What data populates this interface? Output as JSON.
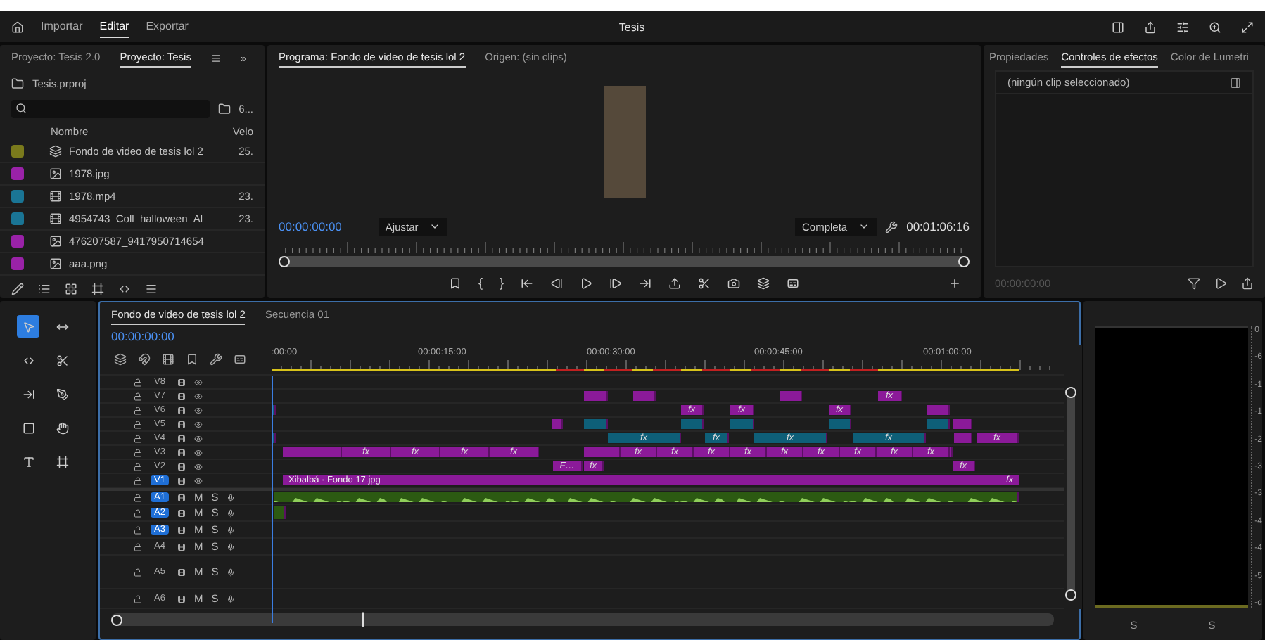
{
  "topbar": {
    "tabs": [
      {
        "label": "Importar",
        "selected": false
      },
      {
        "label": "Editar",
        "selected": true
      },
      {
        "label": "Exportar",
        "selected": false
      }
    ],
    "title": "Tesis"
  },
  "project": {
    "tabs": [
      {
        "label": "Proyecto: Tesis 2.0",
        "selected": false
      },
      {
        "label": "Proyecto: Tesis",
        "selected": true
      }
    ],
    "overflow": "»",
    "file": "Tesis.prproj",
    "count": "6...",
    "columns": [
      "Nombre",
      "Velo"
    ],
    "items": [
      {
        "name": "Fondo de video de tesis lol 2",
        "rate": "25.",
        "color": "#7a7a1c",
        "kind": "sequence",
        "selected": false
      },
      {
        "name": "1978.jpg",
        "color": "#9a22a8",
        "kind": "image",
        "selected": false
      },
      {
        "name": "1978.mp4",
        "rate": "23.",
        "color": "#1a7595",
        "kind": "video",
        "selected": false
      },
      {
        "name": "4954743_Coll_halloween_Al",
        "rate": "23.",
        "color": "#1a7595",
        "kind": "video",
        "selected": false
      },
      {
        "name": "476207587_9417950714654",
        "color": "#9a22a8",
        "kind": "image",
        "selected": false
      },
      {
        "name": "aaa.png",
        "color": "#9a22a8",
        "kind": "image",
        "selected": false
      }
    ]
  },
  "program": {
    "tabs": [
      {
        "label": "Programa: Fondo de video de tesis lol 2",
        "selected": true
      },
      {
        "label": "Origen: (sin clips)",
        "selected": false
      }
    ],
    "timecode": "00:00:00:00",
    "zoom": "Ajustar",
    "quality": "Completa",
    "duration": "00:01:06:16",
    "marks": [
      "{",
      "}"
    ]
  },
  "effects": {
    "tabs": [
      {
        "label": "Propiedades",
        "selected": false
      },
      {
        "label": "Controles de efectos",
        "selected": true
      },
      {
        "label": "Color de Lumetri",
        "selected": false
      }
    ],
    "message": "(ningún clip seleccionado)",
    "timecode": "00:00:00:00"
  },
  "timeline": {
    "tabs": [
      {
        "label": "Fondo de video de tesis lol 2",
        "selected": true
      },
      {
        "label": "Secuencia 01",
        "selected": false
      }
    ],
    "timecode": "00:00:00:00",
    "ruler": [
      ":00:00",
      "00:00:15:00",
      "00:00:30:00",
      "00:00:45:00",
      "00:01:00:00"
    ],
    "video_tracks": [
      {
        "name": "V8",
        "selected": false
      },
      {
        "name": "V7",
        "selected": false,
        "clips": [
          {
            "color": "#8b1a99"
          },
          {
            "color": "#8b1a99"
          },
          {
            "color": "#8b1a99"
          },
          {
            "color": "#8b1a99",
            "label": "fx"
          }
        ]
      },
      {
        "name": "V6",
        "selected": false,
        "clips": [
          {
            "color": "#0e5f78"
          },
          {
            "color": "#8b1a99",
            "label": "fx"
          },
          {
            "color": "#8b1a99",
            "label": "fx"
          },
          {
            "color": "#8b1a99",
            "label": "fx"
          },
          {
            "color": "#8b1a99"
          }
        ]
      },
      {
        "name": "V5",
        "selected": false,
        "clips": [
          {
            "color": "#8b1a99"
          },
          {
            "color": "#0e5f78"
          },
          {
            "color": "#0e5f78"
          },
          {
            "color": "#0e5f78"
          },
          {
            "color": "#0e5f78"
          },
          {
            "color": "#0e5f78"
          },
          {
            "color": "#8b1a99"
          }
        ]
      },
      {
        "name": "V4",
        "selected": false,
        "clips": [
          {
            "color": "#0e5f78"
          },
          {
            "color": "#0e5f78",
            "label": "fx"
          },
          {
            "color": "#0e5f78",
            "label": "fx"
          },
          {
            "color": "#0e5f78",
            "label": "fx"
          },
          {
            "color": "#0e5f78",
            "label": "fx"
          },
          {
            "color": "#8b1a99"
          },
          {
            "color": "#8b1a99",
            "label": "fx"
          }
        ]
      },
      {
        "name": "V3",
        "selected": false,
        "clips": [
          {
            "color": "#8b1a99"
          },
          {
            "color": "#8b1a99",
            "label": "fx"
          },
          {
            "color": "#8b1a99",
            "label": "fx"
          },
          {
            "color": "#8b1a99",
            "label": "fx"
          },
          {
            "color": "#8b1a99",
            "label": "fx"
          },
          {
            "color": "#8b1a99"
          },
          {
            "color": "#8b1a99",
            "label": "fx"
          },
          {
            "color": "#8b1a99",
            "label": "fx"
          },
          {
            "color": "#8b1a99",
            "label": "fx"
          },
          {
            "color": "#8b1a99",
            "label": "fx"
          },
          {
            "color": "#8b1a99",
            "label": "fx"
          },
          {
            "color": "#8b1a99",
            "label": "fx"
          },
          {
            "color": "#8b1a99",
            "label": "fx"
          },
          {
            "color": "#8b1a99",
            "label": "fx"
          },
          {
            "color": "#8b1a99",
            "label": "fx"
          },
          {
            "color": "#8b1a99"
          }
        ]
      },
      {
        "name": "V2",
        "selected": false,
        "clips": [
          {
            "color": "#8b1a99",
            "label": "F…"
          },
          {
            "color": "#8b1a99",
            "label": "fx"
          },
          {
            "color": "#8b1a99",
            "label": "fx"
          }
        ]
      },
      {
        "name": "V1",
        "selected": true,
        "clips": [
          {
            "color": "#8b1a99",
            "label": "Xibalbá · Fondo 17.jpg",
            "badge": "fx"
          }
        ]
      }
    ],
    "audio_tracks": [
      {
        "name": "A1",
        "selected": true,
        "mute": "M",
        "solo": "S",
        "clips": [
          {
            "color": "#2c5a12"
          }
        ]
      },
      {
        "name": "A2",
        "selected": true,
        "mute": "M",
        "solo": "S",
        "clips": [
          {
            "color": "#2c5a12"
          }
        ]
      },
      {
        "name": "A3",
        "selected": true,
        "mute": "M",
        "solo": "S"
      },
      {
        "name": "A4",
        "selected": false,
        "mute": "M",
        "solo": "S"
      },
      {
        "name": "A5",
        "selected": false,
        "mute": "M",
        "solo": "S"
      },
      {
        "name": "A6",
        "selected": false,
        "mute": "M",
        "solo": "S"
      }
    ]
  },
  "meter": {
    "scale": [
      "0",
      "-6",
      "-1",
      "-1",
      "-2",
      "-3",
      "-3",
      "-4",
      "-4",
      "-5",
      "-d"
    ],
    "channels": [
      "S",
      "S"
    ]
  }
}
